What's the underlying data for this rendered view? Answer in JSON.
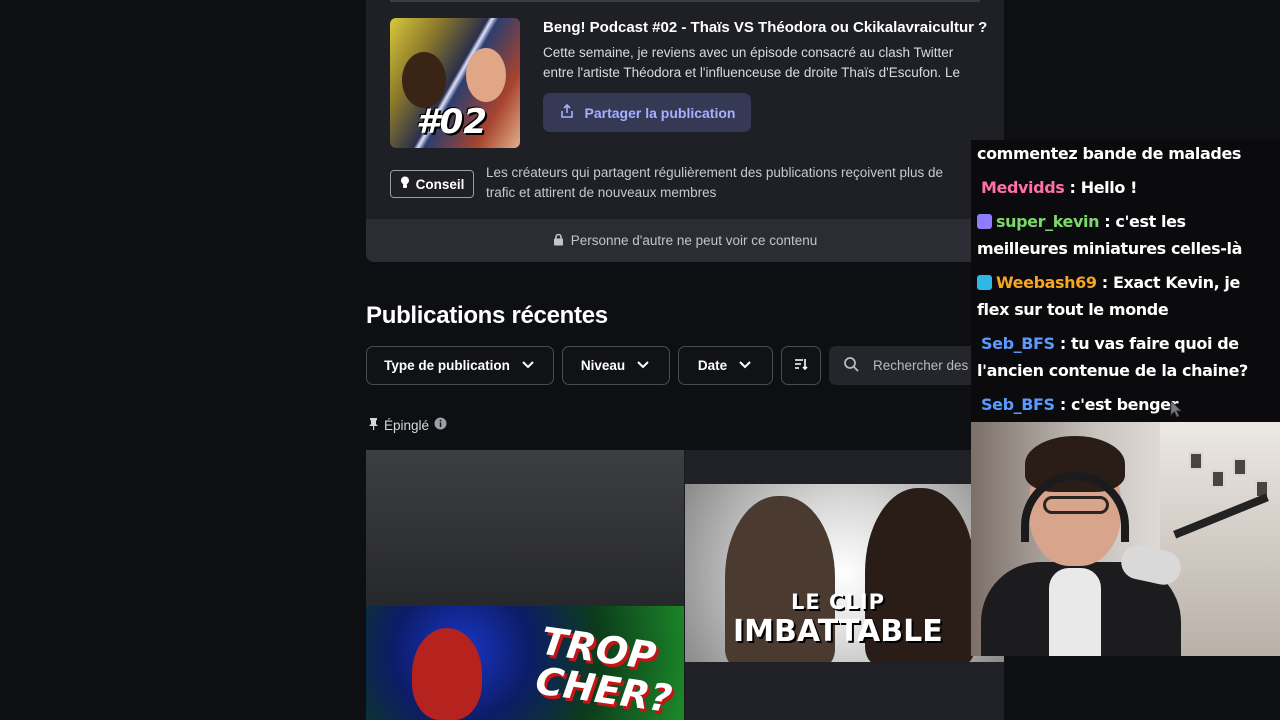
{
  "post": {
    "thumbnail_label": "#02",
    "title": "Beng! Podcast #02 - Thaïs VS Théodora ou Ckikalavraicultur ?",
    "description": "Cette semaine, je reviens avec un épisode consacré au clash Twitter entre l'artiste Théodora et l'influenceuse de droite Thaïs d'Escufon. Le",
    "share_label": "Partager la publication",
    "tip_badge": "Conseil",
    "tip_text": "Les créateurs qui partagent régulièrement des publications reçoivent plus de trafic et attirent de nouveaux membres",
    "privacy_text": "Personne d'autre ne peut voir ce contenu"
  },
  "recent": {
    "title": "Publications récentes",
    "filters": {
      "type": "Type de publication",
      "level": "Niveau",
      "date": "Date"
    },
    "search_placeholder": "Rechercher des",
    "pinned_label": "Épinglé",
    "tiles": [
      {
        "thumb_text": "TROP\nCHER?"
      },
      {
        "thumb_line1": "LE CLIP",
        "thumb_line2": "IMBATTABLE"
      }
    ]
  },
  "chat": {
    "messages": [
      {
        "user": "",
        "text": "commentez bande de malades",
        "color": "#ffffff",
        "badge": ""
      },
      {
        "user": "Medvidds",
        "text": " : Hello !",
        "color": "#ff6fa8",
        "badge": ""
      },
      {
        "user": "super_kevin",
        "text": " : c'est les meilleures miniatures celles-là",
        "color": "#7bd86a",
        "badge": "#8e7cff"
      },
      {
        "user": "Weebash69",
        "text": " : Exact Kevin, je flex sur tout le monde",
        "color": "#f5a623",
        "badge": "#2fb7e8"
      },
      {
        "user": "Seb_BFS",
        "text": " : tu vas faire quoi de l'ancien contenue de la chaine?",
        "color": "#5b9bff",
        "badge": ""
      },
      {
        "user": "Seb_BFS",
        "text": " : c'est benger",
        "color": "#5b9bff",
        "badge": ""
      }
    ]
  },
  "colors": {
    "accent": "#a6b0ff",
    "background": "#0e0f12",
    "card": "#1f2026"
  }
}
